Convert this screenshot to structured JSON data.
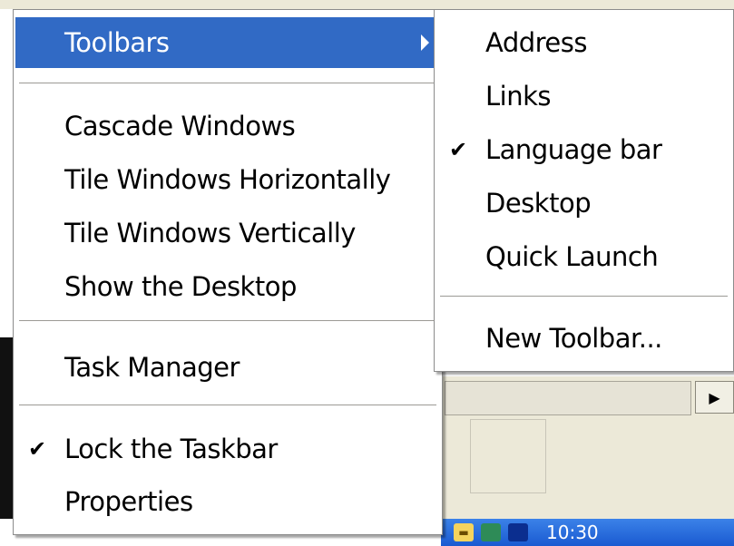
{
  "context_menu": {
    "items": [
      {
        "label": "Toolbars",
        "submenu": true,
        "highlighted": true
      },
      {
        "label": "Cascade Windows"
      },
      {
        "label": "Tile Windows Horizontally"
      },
      {
        "label": "Tile Windows Vertically"
      },
      {
        "label": "Show the Desktop"
      },
      {
        "label": "Task Manager"
      },
      {
        "label": "Lock the Taskbar",
        "checked": true
      },
      {
        "label": "Properties"
      }
    ]
  },
  "toolbars_submenu": {
    "items": [
      {
        "label": "Address"
      },
      {
        "label": "Links"
      },
      {
        "label": "Language bar",
        "checked": true
      },
      {
        "label": "Desktop"
      },
      {
        "label": "Quick Launch"
      },
      {
        "label": "New Toolbar..."
      }
    ]
  },
  "check_glyph": "✔",
  "taskbar": {
    "clock": "10:30"
  },
  "colors": {
    "highlight": "#316ac5",
    "taskbar": "#2462d6",
    "panel": "#ece9d8"
  }
}
